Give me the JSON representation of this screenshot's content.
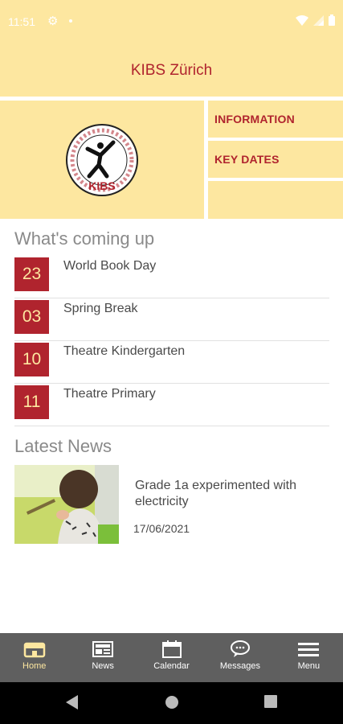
{
  "status": {
    "time": "11:51"
  },
  "app": {
    "title": "KIBS Zürich"
  },
  "hero": {
    "logo_text": "KIBS",
    "tiles": [
      {
        "label": "INFORMATION"
      },
      {
        "label": "KEY DATES"
      }
    ]
  },
  "upcoming": {
    "title": "What's coming up",
    "events": [
      {
        "day": "23",
        "name": "World Book Day"
      },
      {
        "day": "03",
        "name": "Spring Break"
      },
      {
        "day": "10",
        "name": "Theatre Kindergarten"
      },
      {
        "day": "11",
        "name": "Theatre Primary"
      }
    ]
  },
  "news": {
    "title": "Latest News",
    "items": [
      {
        "headline": "Grade 1a experimented with electricity",
        "date": "17/06/2021"
      }
    ]
  },
  "tabs": [
    {
      "label": "Home",
      "icon": "home-icon"
    },
    {
      "label": "News",
      "icon": "news-icon"
    },
    {
      "label": "Calendar",
      "icon": "calendar-icon"
    },
    {
      "label": "Messages",
      "icon": "messages-icon"
    },
    {
      "label": "Menu",
      "icon": "menu-icon"
    }
  ],
  "colors": {
    "brand": "#b0242e",
    "accent": "#fde7a0",
    "tabbar": "#5f5f5f"
  }
}
